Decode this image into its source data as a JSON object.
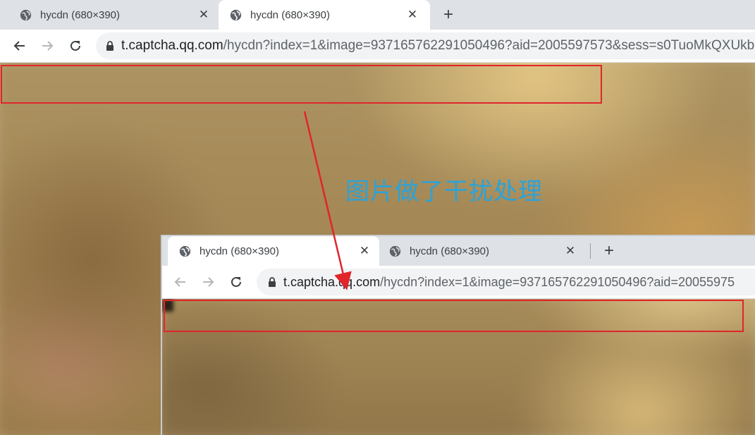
{
  "outer_browser": {
    "tabs": [
      {
        "title": "hycdn (680×390)",
        "active": false
      },
      {
        "title": "hycdn (680×390)",
        "active": true
      }
    ],
    "url_host": "t.captcha.qq.com",
    "url_path": "/hycdn?index=1&image=937165762291050496?aid=2005597573&sess=s0TuoMkQXUkb"
  },
  "inner_browser": {
    "tabs": [
      {
        "title": "hycdn (680×390)",
        "active": true
      },
      {
        "title": "hycdn (680×390)",
        "active": false
      }
    ],
    "url_host": "t.captcha.qq.com",
    "url_path": "/hycdn?index=1&image=937165762291050496?aid=20055975"
  },
  "annotation": {
    "text": "图片做了干扰处理",
    "color": "#2aa3d9"
  },
  "highlight_color": "#e0252b",
  "icons": {
    "tab_favicon": "globe-icon",
    "tab_close": "close-icon",
    "new_tab": "plus-icon",
    "back": "back-arrow-icon",
    "forward": "forward-arrow-icon",
    "reload": "reload-icon",
    "secure": "lock-icon"
  }
}
